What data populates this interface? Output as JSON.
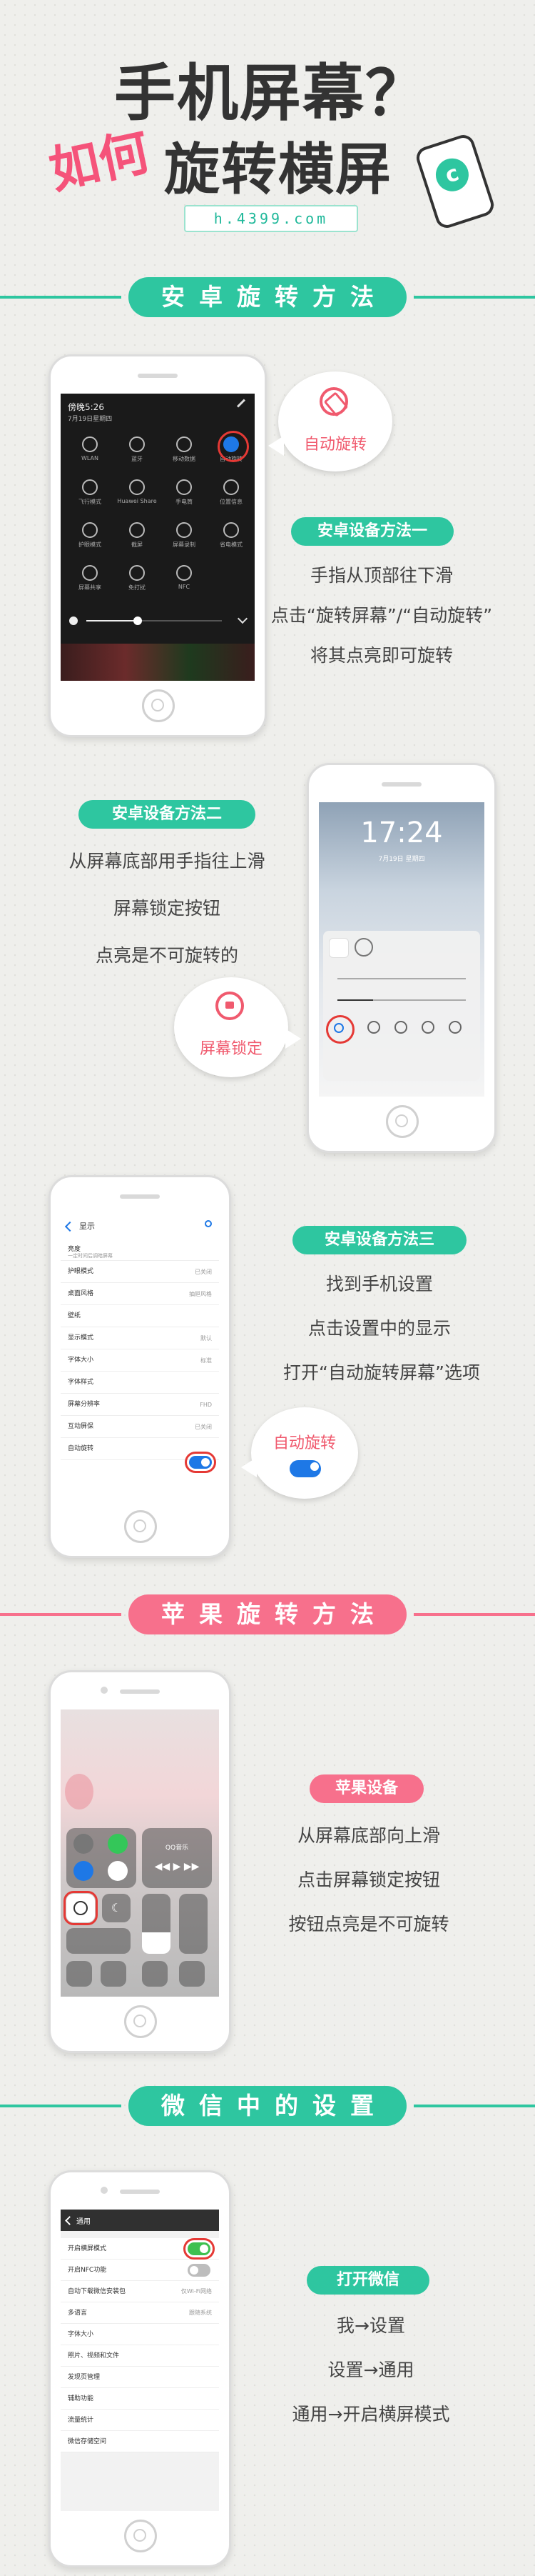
{
  "header": {
    "title_line1": "手机屏幕？",
    "how": "如何",
    "title_line2": "旋转横屏",
    "site": "h.4399.com"
  },
  "colors": {
    "teal": "#2ec6a0",
    "pink": "#f7708c",
    "red_ring": "#e53935"
  },
  "sections": {
    "android": "安卓旋转方法",
    "apple": "苹果旋转方法",
    "wechat": "微信中的设置"
  },
  "android1": {
    "label": "安卓设备方法一",
    "steps": [
      "手指从顶部往下滑",
      "点击“旋转屏幕”/“自动旋转”",
      "将其点亮即可旋转"
    ],
    "bubble": "自动旋转",
    "screen": {
      "time": "傍晚5:26",
      "date": "7月19日星期四",
      "tiles": [
        "WLAN",
        "蓝牙",
        "移动数据",
        "自动旋转",
        "飞行模式",
        "Huawei Share",
        "手电筒",
        "位置信息",
        "护眼模式",
        "截屏",
        "屏幕录制",
        "省电模式",
        "屏幕共享",
        "免打扰",
        "NFC"
      ]
    }
  },
  "android2": {
    "label": "安卓设备方法二",
    "steps": [
      "从屏幕底部用手指往上滑",
      "屏幕锁定按钮",
      "点亮是不可旋转的"
    ],
    "bubble": "屏幕锁定",
    "screen": {
      "time": "17:24",
      "date": "7月19日 星期四"
    }
  },
  "android3": {
    "label": "安卓设备方法三",
    "steps": [
      "找到手机设置",
      "点击设置中的显示",
      "打开“自动旋转屏幕”选项"
    ],
    "bubble": "自动旋转",
    "screen": {
      "title": "显示",
      "rows": [
        {
          "name": "亮度",
          "value": "",
          "note": "一定时间后调暗屏幕"
        },
        {
          "name": "护眼模式",
          "value": "已关闭"
        },
        {
          "name": "桌面风格",
          "value": "抽屉风格"
        },
        {
          "name": "壁纸",
          "value": ""
        },
        {
          "name": "显示模式",
          "value": "默认"
        },
        {
          "name": "字体大小",
          "value": "标准"
        },
        {
          "name": "字体样式",
          "value": ""
        },
        {
          "name": "屏幕分辨率",
          "value": "FHD"
        },
        {
          "name": "互动屏保",
          "value": "已关闭"
        },
        {
          "name": "自动旋转",
          "value": ""
        }
      ]
    }
  },
  "apple": {
    "label": "苹果设备",
    "steps": [
      "从屏幕底部向上滑",
      "点击屏幕锁定按钮",
      "按钮点亮是不可旋转"
    ],
    "screen": {
      "music": "QQ音乐"
    }
  },
  "wechat": {
    "label": "打开微信",
    "steps": [
      "我→设置",
      "设置→通用",
      "通用→开启横屏模式"
    ],
    "screen": {
      "title": "通用",
      "rows": [
        {
          "name": "开启横屏模式",
          "value": ""
        },
        {
          "name": "开启NFC功能",
          "value": ""
        },
        {
          "name": "自动下载微信安装包",
          "value": "仅Wi-Fi网络"
        },
        {
          "name": "多语言",
          "value": "跟随系统"
        },
        {
          "name": "字体大小",
          "value": ""
        },
        {
          "name": "照片、视频和文件",
          "value": ""
        },
        {
          "name": "发现页管理",
          "value": ""
        },
        {
          "name": "辅助功能",
          "value": ""
        },
        {
          "name": "流量统计",
          "value": ""
        },
        {
          "name": "微信存储空间",
          "value": ""
        }
      ]
    }
  }
}
